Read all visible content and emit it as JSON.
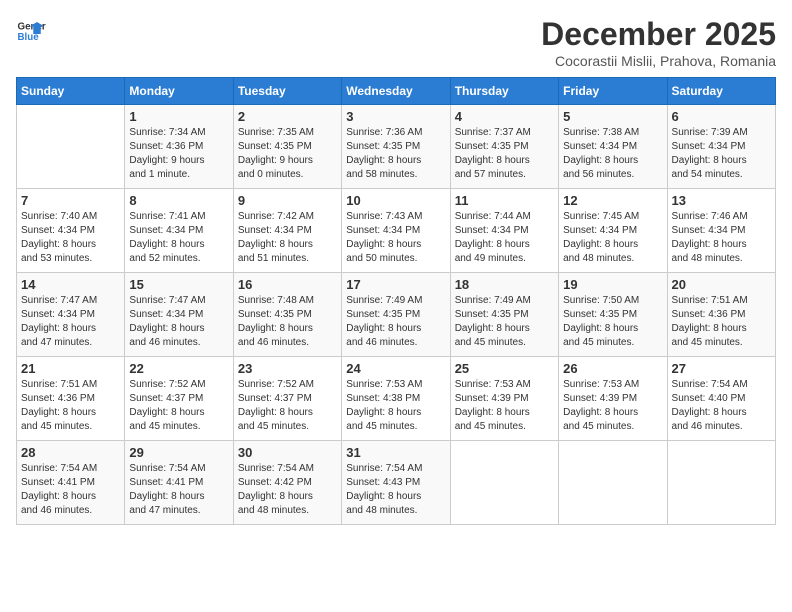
{
  "logo": {
    "line1": "General",
    "line2": "Blue"
  },
  "title": "December 2025",
  "location": "Cocorastii Mislii, Prahova, Romania",
  "days_of_week": [
    "Sunday",
    "Monday",
    "Tuesday",
    "Wednesday",
    "Thursday",
    "Friday",
    "Saturday"
  ],
  "weeks": [
    [
      {
        "day": "",
        "info": ""
      },
      {
        "day": "1",
        "info": "Sunrise: 7:34 AM\nSunset: 4:36 PM\nDaylight: 9 hours\nand 1 minute."
      },
      {
        "day": "2",
        "info": "Sunrise: 7:35 AM\nSunset: 4:35 PM\nDaylight: 9 hours\nand 0 minutes."
      },
      {
        "day": "3",
        "info": "Sunrise: 7:36 AM\nSunset: 4:35 PM\nDaylight: 8 hours\nand 58 minutes."
      },
      {
        "day": "4",
        "info": "Sunrise: 7:37 AM\nSunset: 4:35 PM\nDaylight: 8 hours\nand 57 minutes."
      },
      {
        "day": "5",
        "info": "Sunrise: 7:38 AM\nSunset: 4:34 PM\nDaylight: 8 hours\nand 56 minutes."
      },
      {
        "day": "6",
        "info": "Sunrise: 7:39 AM\nSunset: 4:34 PM\nDaylight: 8 hours\nand 54 minutes."
      }
    ],
    [
      {
        "day": "7",
        "info": "Sunrise: 7:40 AM\nSunset: 4:34 PM\nDaylight: 8 hours\nand 53 minutes."
      },
      {
        "day": "8",
        "info": "Sunrise: 7:41 AM\nSunset: 4:34 PM\nDaylight: 8 hours\nand 52 minutes."
      },
      {
        "day": "9",
        "info": "Sunrise: 7:42 AM\nSunset: 4:34 PM\nDaylight: 8 hours\nand 51 minutes."
      },
      {
        "day": "10",
        "info": "Sunrise: 7:43 AM\nSunset: 4:34 PM\nDaylight: 8 hours\nand 50 minutes."
      },
      {
        "day": "11",
        "info": "Sunrise: 7:44 AM\nSunset: 4:34 PM\nDaylight: 8 hours\nand 49 minutes."
      },
      {
        "day": "12",
        "info": "Sunrise: 7:45 AM\nSunset: 4:34 PM\nDaylight: 8 hours\nand 48 minutes."
      },
      {
        "day": "13",
        "info": "Sunrise: 7:46 AM\nSunset: 4:34 PM\nDaylight: 8 hours\nand 48 minutes."
      }
    ],
    [
      {
        "day": "14",
        "info": "Sunrise: 7:47 AM\nSunset: 4:34 PM\nDaylight: 8 hours\nand 47 minutes."
      },
      {
        "day": "15",
        "info": "Sunrise: 7:47 AM\nSunset: 4:34 PM\nDaylight: 8 hours\nand 46 minutes."
      },
      {
        "day": "16",
        "info": "Sunrise: 7:48 AM\nSunset: 4:35 PM\nDaylight: 8 hours\nand 46 minutes."
      },
      {
        "day": "17",
        "info": "Sunrise: 7:49 AM\nSunset: 4:35 PM\nDaylight: 8 hours\nand 46 minutes."
      },
      {
        "day": "18",
        "info": "Sunrise: 7:49 AM\nSunset: 4:35 PM\nDaylight: 8 hours\nand 45 minutes."
      },
      {
        "day": "19",
        "info": "Sunrise: 7:50 AM\nSunset: 4:35 PM\nDaylight: 8 hours\nand 45 minutes."
      },
      {
        "day": "20",
        "info": "Sunrise: 7:51 AM\nSunset: 4:36 PM\nDaylight: 8 hours\nand 45 minutes."
      }
    ],
    [
      {
        "day": "21",
        "info": "Sunrise: 7:51 AM\nSunset: 4:36 PM\nDaylight: 8 hours\nand 45 minutes."
      },
      {
        "day": "22",
        "info": "Sunrise: 7:52 AM\nSunset: 4:37 PM\nDaylight: 8 hours\nand 45 minutes."
      },
      {
        "day": "23",
        "info": "Sunrise: 7:52 AM\nSunset: 4:37 PM\nDaylight: 8 hours\nand 45 minutes."
      },
      {
        "day": "24",
        "info": "Sunrise: 7:53 AM\nSunset: 4:38 PM\nDaylight: 8 hours\nand 45 minutes."
      },
      {
        "day": "25",
        "info": "Sunrise: 7:53 AM\nSunset: 4:39 PM\nDaylight: 8 hours\nand 45 minutes."
      },
      {
        "day": "26",
        "info": "Sunrise: 7:53 AM\nSunset: 4:39 PM\nDaylight: 8 hours\nand 45 minutes."
      },
      {
        "day": "27",
        "info": "Sunrise: 7:54 AM\nSunset: 4:40 PM\nDaylight: 8 hours\nand 46 minutes."
      }
    ],
    [
      {
        "day": "28",
        "info": "Sunrise: 7:54 AM\nSunset: 4:41 PM\nDaylight: 8 hours\nand 46 minutes."
      },
      {
        "day": "29",
        "info": "Sunrise: 7:54 AM\nSunset: 4:41 PM\nDaylight: 8 hours\nand 47 minutes."
      },
      {
        "day": "30",
        "info": "Sunrise: 7:54 AM\nSunset: 4:42 PM\nDaylight: 8 hours\nand 48 minutes."
      },
      {
        "day": "31",
        "info": "Sunrise: 7:54 AM\nSunset: 4:43 PM\nDaylight: 8 hours\nand 48 minutes."
      },
      {
        "day": "",
        "info": ""
      },
      {
        "day": "",
        "info": ""
      },
      {
        "day": "",
        "info": ""
      }
    ]
  ]
}
